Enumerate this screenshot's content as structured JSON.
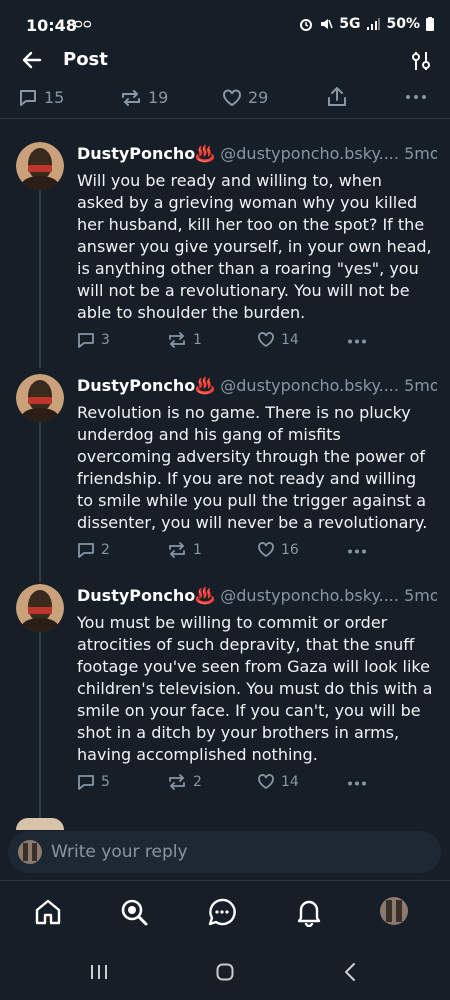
{
  "status_bar": {
    "time": "10:48",
    "network": "5G",
    "battery": "50%"
  },
  "header": {
    "title": "Post"
  },
  "parent_actions": {
    "replies": "15",
    "reposts": "19",
    "likes": "29"
  },
  "posts": [
    {
      "name": "DustyPoncho♨️",
      "handle": "@dustyponcho.bsky....",
      "time": "5mo",
      "text": "Will you be ready and willing to, when asked by a grieving woman why you killed her husband, kill her too on the spot? If the answer you give yourself, in your own head, is anything other than a roaring \"yes\", you will not be a revolutionary. You will not be able to shoulder the burden.",
      "replies": "3",
      "reposts": "1",
      "likes": "14"
    },
    {
      "name": "DustyPoncho♨️",
      "handle": "@dustyponcho.bsky....",
      "time": "5mo",
      "text": "Revolution is no game. There is no plucky underdog and his gang of misfits overcoming adversity through the power of friendship. If you are not ready and willing to smile while you pull the trigger against a dissenter, you will never be a revolutionary.",
      "replies": "2",
      "reposts": "1",
      "likes": "16"
    },
    {
      "name": "DustyPoncho♨️",
      "handle": "@dustyponcho.bsky....",
      "time": "5mo",
      "text": "You must be willing to commit or order atrocities of such depravity, that the snuff footage you've seen from Gaza will look like children's television. You must do this with a smile on your face. If you can't, you will be shot in a ditch by your brothers in arms, having accomplished nothing.",
      "replies": "5",
      "reposts": "2",
      "likes": "14"
    }
  ],
  "reply_box": {
    "placeholder": "Write your reply"
  },
  "nav": [
    "home-icon",
    "search-icon",
    "chat-icon",
    "bell-icon",
    "profile-avatar"
  ]
}
